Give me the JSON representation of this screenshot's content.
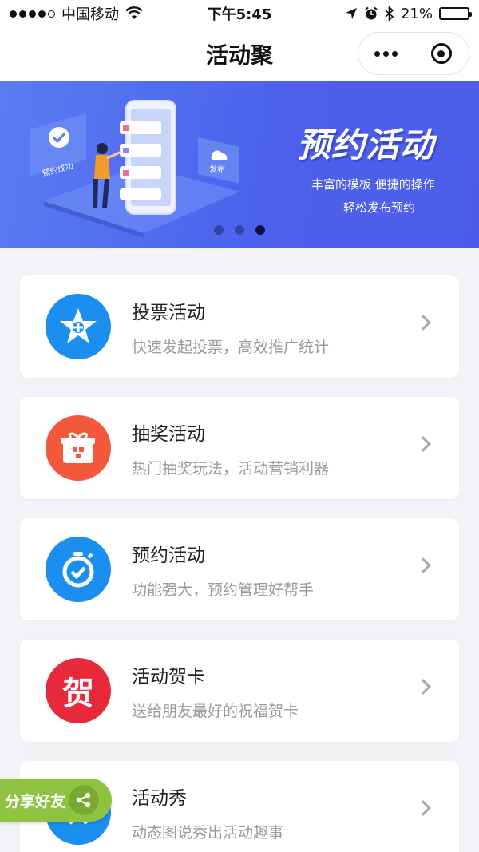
{
  "status_bar": {
    "carrier": "中国移动",
    "time": "下午5:45",
    "battery": "21%",
    "battery_level": 0.21
  },
  "nav": {
    "title": "活动聚",
    "menu_icon": "more-dots-icon",
    "close_icon": "target-circle-icon"
  },
  "banner": {
    "title": "预约活动",
    "subtitle_1": "丰富的模板  便捷的操作",
    "subtitle_2": "轻松发布预约",
    "badge_left": "预约成功",
    "badge_right": "发布",
    "slides": 3,
    "active_slide": 3
  },
  "items": [
    {
      "title": "投票活动",
      "desc": "快速发起投票，高效推广统计",
      "color": "#1a8ff0",
      "icon": "vote-star-icon"
    },
    {
      "title": "抽奖活动",
      "desc": "热门抽奖玩法，活动营销利器",
      "color": "#f4583a",
      "icon": "gift-icon"
    },
    {
      "title": "预约活动",
      "desc": "功能强大，预约管理好帮手",
      "color": "#1a8ff0",
      "icon": "stopwatch-check-icon"
    },
    {
      "title": "活动贺卡",
      "desc": "送给朋友最好的祝福贺卡",
      "color": "#e8293c",
      "icon": "greeting-card-icon",
      "icon_text": "贺"
    },
    {
      "title": "活动秀",
      "desc": "动态图说秀出活动趣事",
      "color": "#1a8ff0",
      "icon": "show-icon"
    }
  ],
  "share": {
    "label": "分享好友",
    "icon": "share-icon",
    "color": "#8dc341"
  }
}
